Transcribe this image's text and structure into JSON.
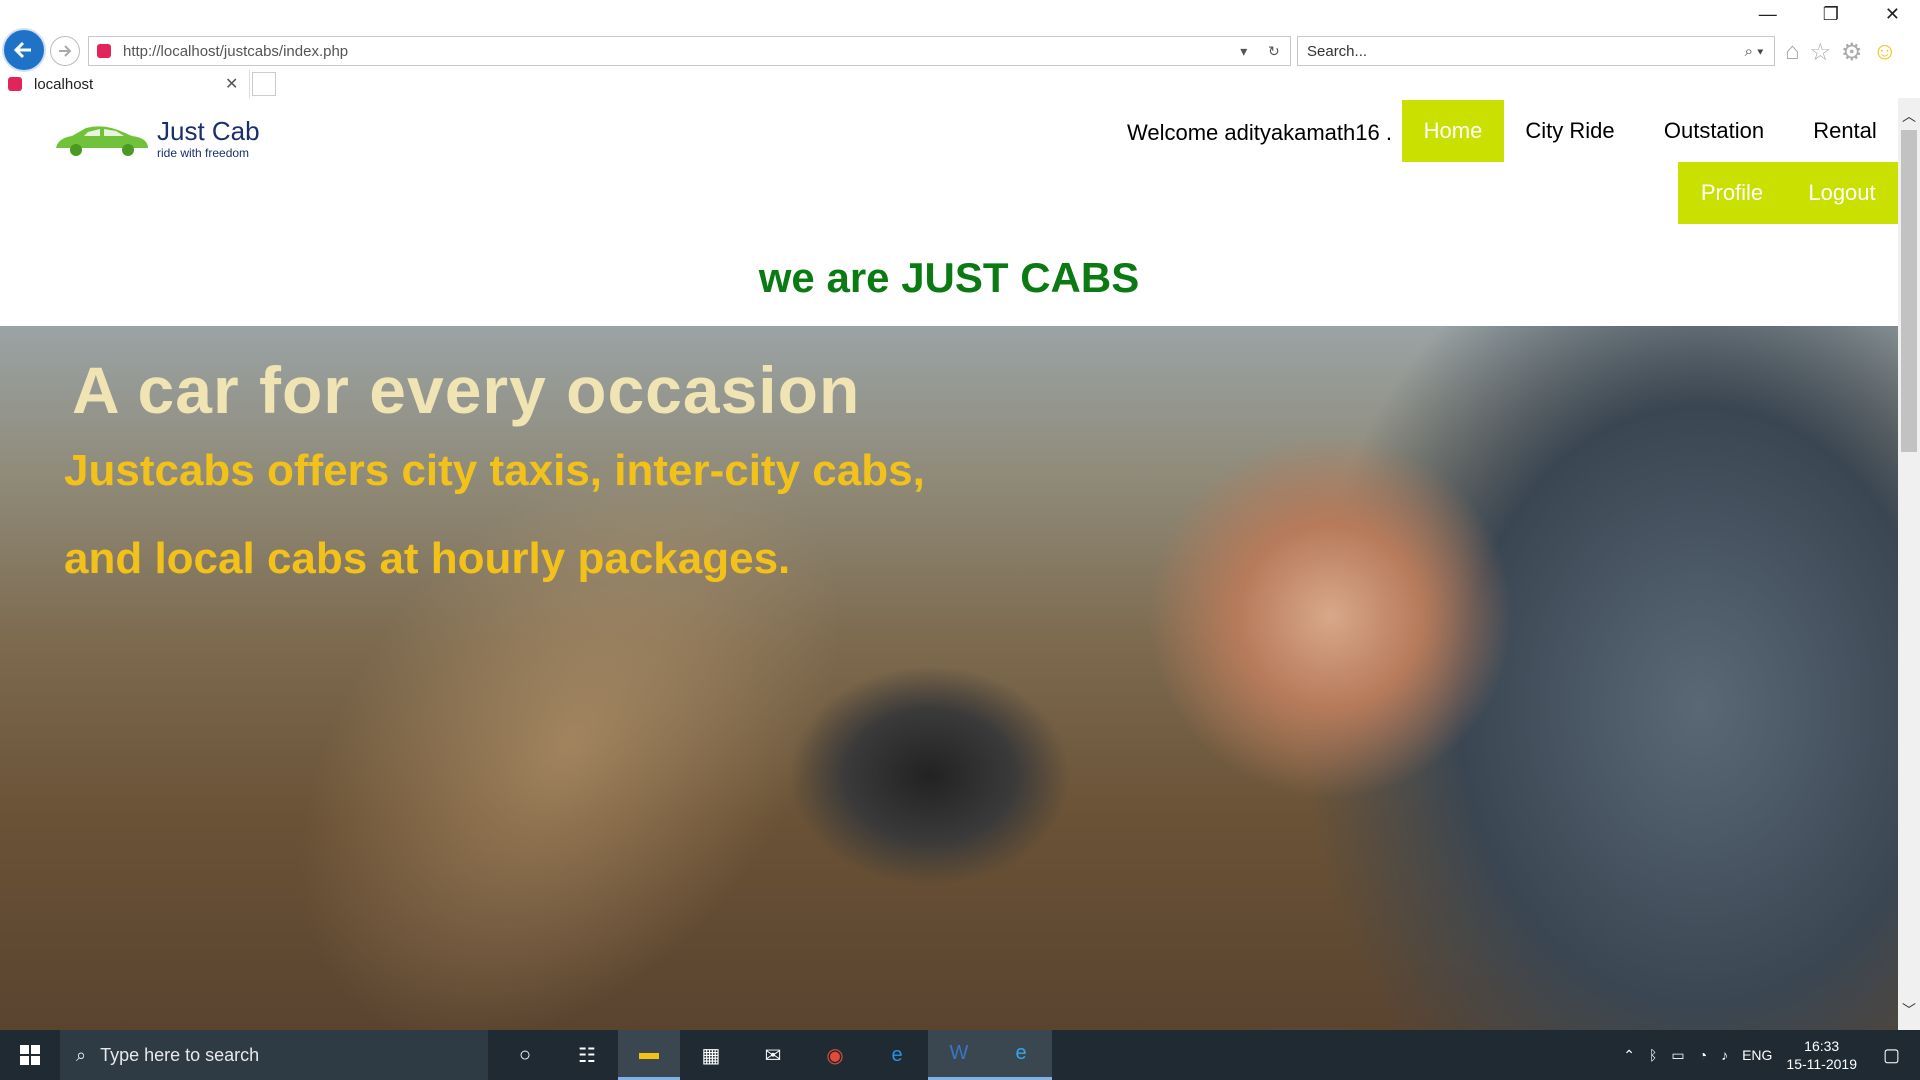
{
  "browser": {
    "url": "http://localhost/justcabs/index.php",
    "search_placeholder": "Search...",
    "tab_title": "localhost"
  },
  "site": {
    "logo_name": "Just Cab",
    "logo_tagline": "ride with freedom",
    "welcome": "Welcome adityakamath16 .",
    "menu": [
      "Home",
      "City Ride",
      "Outstation",
      "Rental"
    ],
    "submenu": [
      "Profile",
      "Logout"
    ],
    "heading": "we are JUST CABS"
  },
  "hero": {
    "title": "A car for every occasion",
    "line1": "Justcabs offers city taxis, inter-city cabs,",
    "line2": "and local cabs at hourly packages."
  },
  "taskbar": {
    "search_placeholder": "Type here to search",
    "lang": "ENG",
    "time": "16:33",
    "date": "15-11-2019"
  },
  "colors": {
    "menu_active": "#c9e000",
    "heading": "#0b7a12",
    "hero_title": "#f0e3b4",
    "hero_text": "#f2c21b"
  }
}
